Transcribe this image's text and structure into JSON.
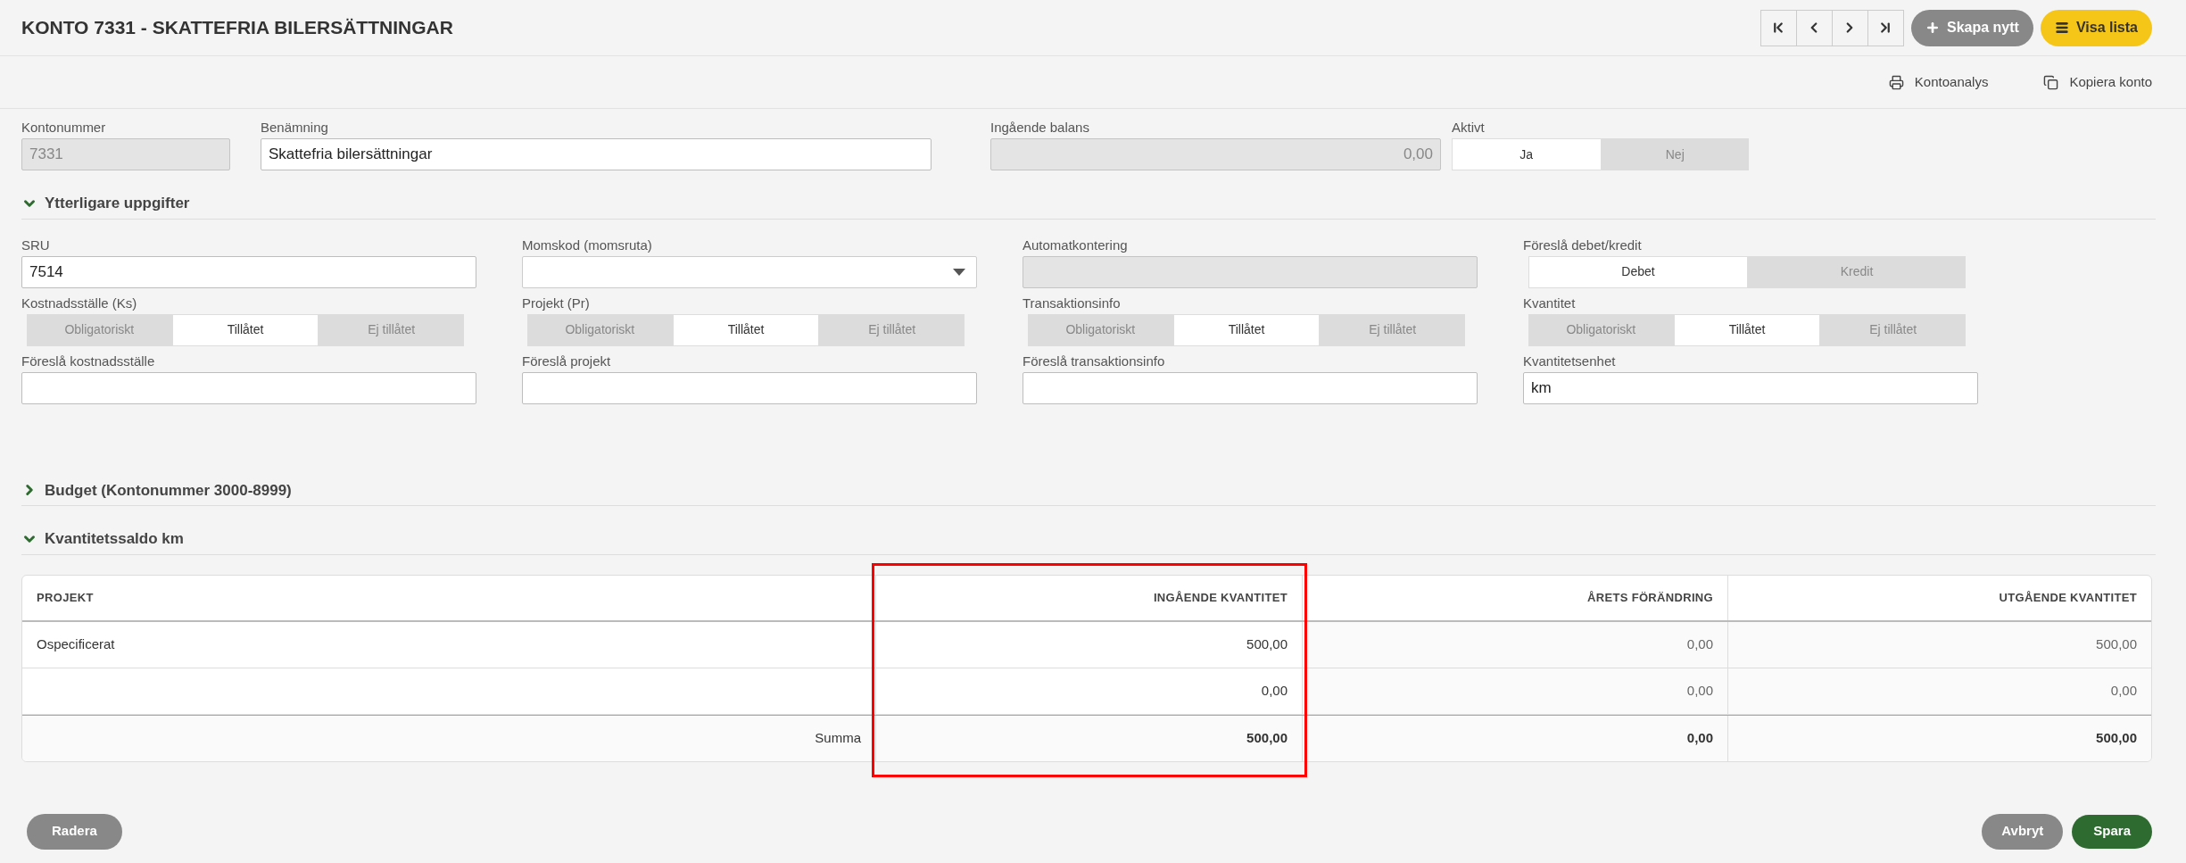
{
  "header": {
    "title": "KONTO 7331 - SKATTEFRIA BILERSÄTTNINGAR",
    "create_button": "Skapa nytt",
    "list_button": "Visa lista"
  },
  "actions": [
    {
      "kind": "print",
      "label": "Kontoanalys"
    },
    {
      "kind": "copy",
      "label": "Kopiera konto"
    }
  ],
  "top_fields": [
    {
      "kind": "input",
      "label": "Kontonummer",
      "value": "7331",
      "disabled": true
    },
    {
      "kind": "input",
      "label": "Benämning",
      "value": "Skattefria bilersättningar",
      "disabled": false
    },
    {
      "kind": "input",
      "label": "Ingående balans",
      "value": "0,00",
      "disabled": true
    },
    {
      "kind": "toggle",
      "label": "Aktivt",
      "options": [
        {
          "label": "Ja",
          "selected": true
        },
        {
          "label": "Nej",
          "selected": false
        }
      ]
    }
  ],
  "sections": [
    {
      "title": "Ytterligare uppgifter",
      "expanded": true,
      "fields": [
        {
          "kind": "input",
          "label": "SRU",
          "value": "7514",
          "disabled": false
        },
        {
          "kind": "select",
          "label": "Momskod (momsruta)"
        },
        {
          "kind": "input",
          "label": "Automatkontering",
          "disabled": true
        },
        {
          "kind": "toggle",
          "label": "Föreslå debet/kredit",
          "options": [
            {
              "label": "Debet",
              "selected": true
            },
            {
              "label": "Kredit",
              "selected": false
            }
          ]
        },
        {
          "kind": "toggle",
          "label": "Kostnadsställe (Ks)",
          "options": [
            {
              "label": "Obligatoriskt",
              "selected": false
            },
            {
              "label": "Tillåtet",
              "selected": true
            },
            {
              "label": "Ej tillåtet",
              "selected": false
            }
          ]
        },
        {
          "kind": "toggle",
          "label": "Projekt (Pr)",
          "options": [
            {
              "label": "Obligatoriskt",
              "selected": false
            },
            {
              "label": "Tillåtet",
              "selected": true
            },
            {
              "label": "Ej tillåtet",
              "selected": false
            }
          ]
        },
        {
          "kind": "toggle",
          "label": "Transaktionsinfo",
          "options": [
            {
              "label": "Obligatoriskt",
              "selected": false
            },
            {
              "label": "Tillåtet",
              "selected": true
            },
            {
              "label": "Ej tillåtet",
              "selected": false
            }
          ]
        },
        {
          "kind": "toggle",
          "label": "Kvantitet",
          "options": [
            {
              "label": "Obligatoriskt",
              "selected": false
            },
            {
              "label": "Tillåtet",
              "selected": true
            },
            {
              "label": "Ej tillåtet",
              "selected": false
            }
          ]
        },
        {
          "kind": "input",
          "label": "Föreslå kostnadsställe",
          "disabled": false
        },
        {
          "kind": "input",
          "label": "Föreslå projekt",
          "disabled": false
        },
        {
          "kind": "input",
          "label": "Föreslå transaktionsinfo",
          "disabled": false
        },
        {
          "kind": "input",
          "label": "Kvantitetsenhet",
          "value": "km",
          "disabled": false
        }
      ]
    },
    {
      "title": "Budget (Kontonummer 3000-8999)",
      "expanded": false
    },
    {
      "title": "Kvantitetssaldo km",
      "expanded": true,
      "table": {
        "columns": [
          {
            "label": "PROJEKT",
            "highlighted": false
          },
          {
            "label": "INGÅENDE KVANTITET",
            "highlighted": true
          },
          {
            "label": "ÅRETS FÖRÄNDRING",
            "highlighted": false
          },
          {
            "label": "UTGÅENDE KVANTITET",
            "highlighted": false
          }
        ],
        "rows": [
          [
            "Ospecificerat",
            "500,00",
            "0,00",
            "500,00"
          ],
          [
            null,
            "0,00",
            "0,00",
            "0,00"
          ]
        ],
        "totals": [
          "Summa",
          "500,00",
          "0,00",
          "500,00"
        ]
      }
    }
  ],
  "footer": {
    "delete_button": "Radera",
    "cancel_button": "Avbryt",
    "save_button": "Spara"
  }
}
